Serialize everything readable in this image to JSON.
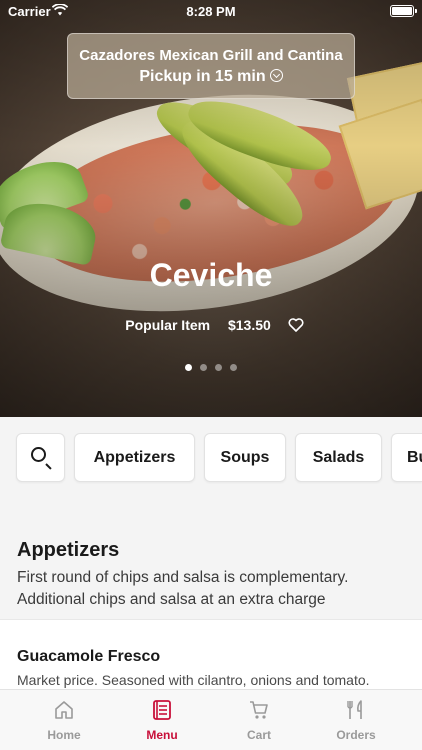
{
  "status_bar": {
    "carrier": "Carrier",
    "time": "8:28 PM"
  },
  "header": {
    "restaurant_name": "Cazadores Mexican Grill and Cantina",
    "pickup_label": "Pickup in 15 min"
  },
  "featured": {
    "title": "Ceviche",
    "badge": "Popular Item",
    "price": "$13.50",
    "carousel_pages": 4,
    "active_page": 1
  },
  "categories": [
    {
      "label": "Appetizers"
    },
    {
      "label": "Soups"
    },
    {
      "label": "Salads"
    },
    {
      "label": "Bu"
    }
  ],
  "section": {
    "title": "Appetizers",
    "description_line1": "First round of chips and salsa is complementary.",
    "description_line2": "Additional chips and salsa at an extra charge"
  },
  "items": [
    {
      "name": "Guacamole Fresco",
      "description": "Market price. Seasoned with cilantro, onions and tomato."
    }
  ],
  "tabbar": {
    "tabs": [
      {
        "label": "Home",
        "icon": "home-icon"
      },
      {
        "label": "Menu",
        "icon": "menu-icon",
        "active": true
      },
      {
        "label": "Cart",
        "icon": "cart-icon"
      },
      {
        "label": "Orders",
        "icon": "orders-icon"
      }
    ]
  },
  "colors": {
    "accent": "#c8103a",
    "inactive": "#9a9a9a"
  }
}
